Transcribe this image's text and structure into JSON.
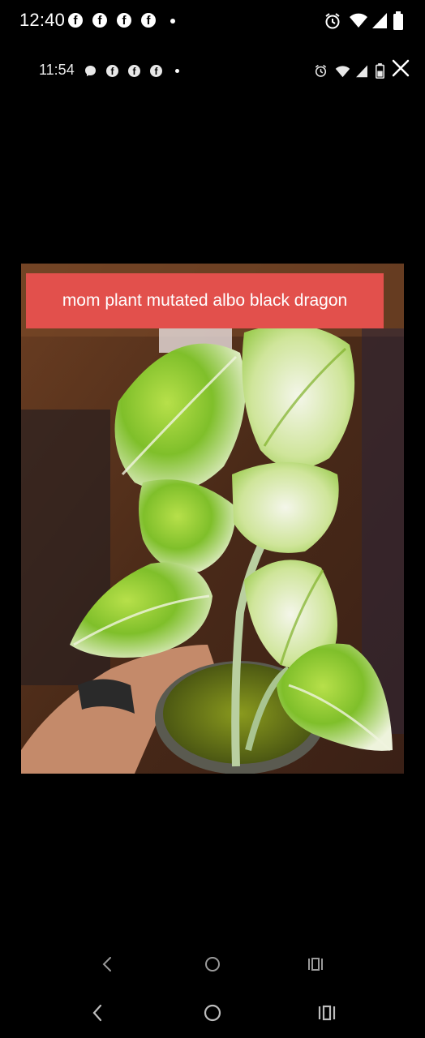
{
  "status_bar": {
    "time": "12:40",
    "app_icons": [
      "facebook-icon",
      "facebook-icon",
      "facebook-icon"
    ]
  },
  "inner_status_bar": {
    "time": "11:54",
    "app_icons": [
      "messenger-icon",
      "facebook-icon",
      "facebook-icon",
      "facebook-icon"
    ]
  },
  "viewer": {
    "caption": "mom plant mutated albo black dragon",
    "image_subject": "variegated pothos plant"
  },
  "nav_bars": [
    "back-icon",
    "home-icon",
    "recents-icon"
  ]
}
